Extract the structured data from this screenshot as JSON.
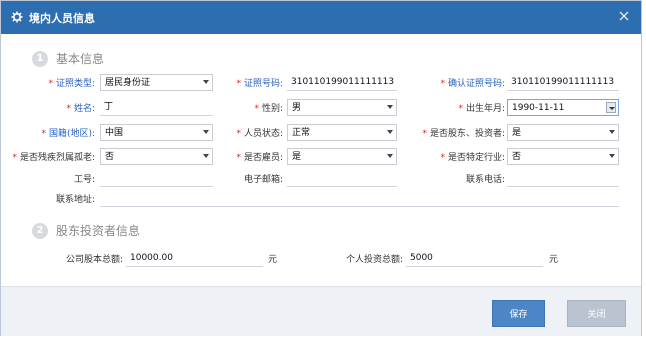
{
  "dialog": {
    "title": "境内人员信息"
  },
  "section1": {
    "num": "1",
    "title": "基本信息"
  },
  "section2": {
    "num": "2",
    "title": "股东投资者信息"
  },
  "fields": {
    "id_type": {
      "label": "证照类型:",
      "value": "居民身份证"
    },
    "id_number": {
      "label": "证照号码:",
      "value": "310110199011111113"
    },
    "confirm_id_number": {
      "label": "确认证照号码:",
      "value": "310110199011111113"
    },
    "name": {
      "label": "姓名:",
      "value": "丁"
    },
    "gender": {
      "label": "性别:",
      "value": "男"
    },
    "birth": {
      "label": "出生年月:",
      "value": "1990-11-11"
    },
    "nationality": {
      "label": "国籍(地区):",
      "value": "中国"
    },
    "status": {
      "label": "人员状态:",
      "value": "正常"
    },
    "is_shareholder": {
      "label": "是否股东、投资者:",
      "value": "是"
    },
    "is_disabled": {
      "label": "是否残疾烈属孤老:",
      "value": "否"
    },
    "is_employee": {
      "label": "是否雇员:",
      "value": "是"
    },
    "is_special_industry": {
      "label": "是否特定行业:",
      "value": "否"
    },
    "employee_no": {
      "label": "工号:",
      "value": ""
    },
    "email": {
      "label": "电子邮箱:",
      "value": ""
    },
    "phone": {
      "label": "联系电话:",
      "value": ""
    },
    "address": {
      "label": "联系地址:",
      "value": ""
    },
    "company_equity": {
      "label": "公司股本总额:",
      "value": "10000.00",
      "unit": "元"
    },
    "personal_investment": {
      "label": "个人投资总额:",
      "value": "5000",
      "unit": "元"
    }
  },
  "buttons": {
    "save": "保存",
    "close": "关闭"
  }
}
